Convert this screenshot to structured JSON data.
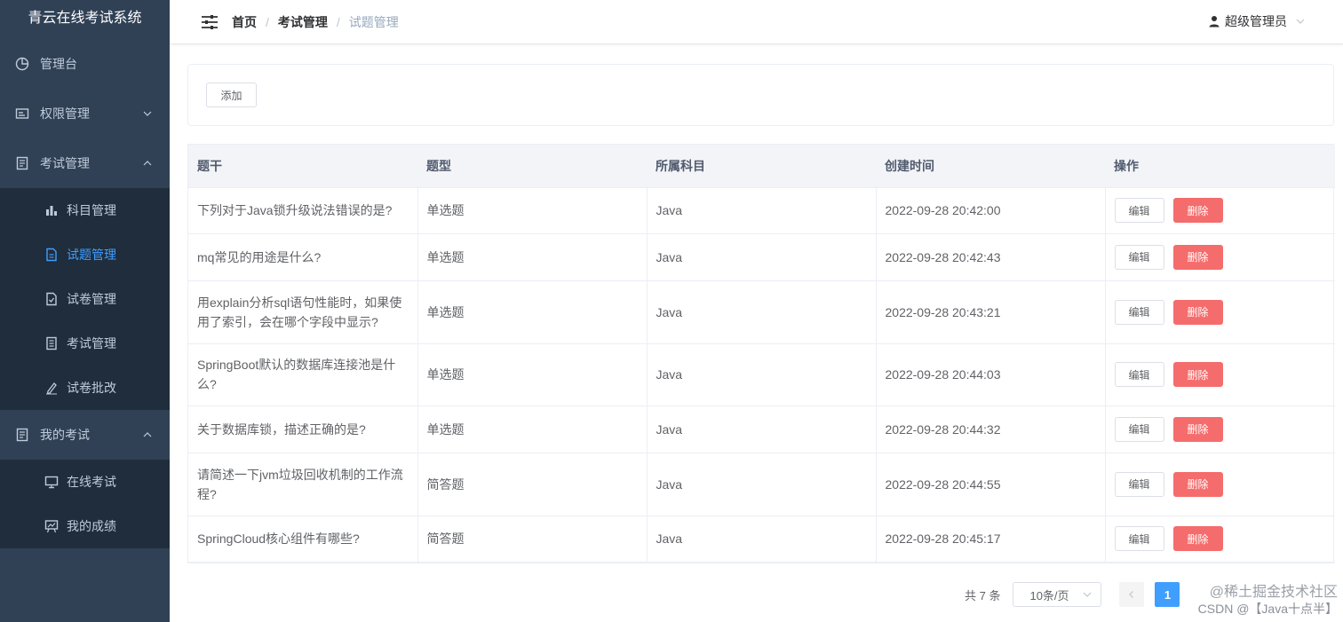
{
  "app": {
    "title": "青云在线考试系统"
  },
  "sidebar": {
    "items": [
      {
        "label": "管理台",
        "icon": "pie-chart-icon"
      },
      {
        "label": "权限管理",
        "icon": "id-card-icon",
        "expanded": false
      },
      {
        "label": "考试管理",
        "icon": "document-icon",
        "expanded": true,
        "children": [
          {
            "label": "科目管理",
            "icon": "bar-chart-icon"
          },
          {
            "label": "试题管理",
            "icon": "file-text-icon",
            "active": true
          },
          {
            "label": "试卷管理",
            "icon": "file-check-icon"
          },
          {
            "label": "考试管理",
            "icon": "notebook-icon"
          },
          {
            "label": "试卷批改",
            "icon": "pen-icon"
          }
        ]
      },
      {
        "label": "我的考试",
        "icon": "document-icon",
        "expanded": true,
        "children": [
          {
            "label": "在线考试",
            "icon": "monitor-icon"
          },
          {
            "label": "我的成绩",
            "icon": "presentation-icon"
          }
        ]
      }
    ]
  },
  "header": {
    "breadcrumb": [
      "首页",
      "考试管理",
      "试题管理"
    ],
    "separator": "/",
    "user": "超级管理员"
  },
  "toolbar": {
    "add_label": "添加"
  },
  "table": {
    "columns": [
      "题干",
      "题型",
      "所属科目",
      "创建时间",
      "操作"
    ],
    "rows": [
      {
        "stem": "下列对于Java锁升级说法错误的是?",
        "type": "单选题",
        "subject": "Java",
        "created": "2022-09-28 20:42:00"
      },
      {
        "stem": "mq常见的用途是什么?",
        "type": "单选题",
        "subject": "Java",
        "created": "2022-09-28 20:42:43"
      },
      {
        "stem": "用explain分析sql语句性能时，如果使用了索引，会在哪个字段中显示?",
        "type": "单选题",
        "subject": "Java",
        "created": "2022-09-28 20:43:21"
      },
      {
        "stem": "SpringBoot默认的数据库连接池是什么?",
        "type": "单选题",
        "subject": "Java",
        "created": "2022-09-28 20:44:03"
      },
      {
        "stem": "关于数据库锁，描述正确的是?",
        "type": "单选题",
        "subject": "Java",
        "created": "2022-09-28 20:44:32"
      },
      {
        "stem": "请简述一下jvm垃圾回收机制的工作流程?",
        "type": "简答题",
        "subject": "Java",
        "created": "2022-09-28 20:44:55"
      },
      {
        "stem": "SpringCloud核心组件有哪些?",
        "type": "简答题",
        "subject": "Java",
        "created": "2022-09-28 20:45:17"
      }
    ],
    "edit_label": "编辑",
    "delete_label": "删除"
  },
  "pagination": {
    "total_text": "共 7 条",
    "page_size": "10条/页",
    "current_page": "1"
  },
  "watermark": {
    "line1": "@稀土掘金技术社区",
    "line2": "CSDN @【Java十点半】"
  },
  "colors": {
    "sidebar_bg": "#304156",
    "submenu_bg": "#1f2d3d",
    "active": "#409eff",
    "danger": "#f56c6c"
  }
}
